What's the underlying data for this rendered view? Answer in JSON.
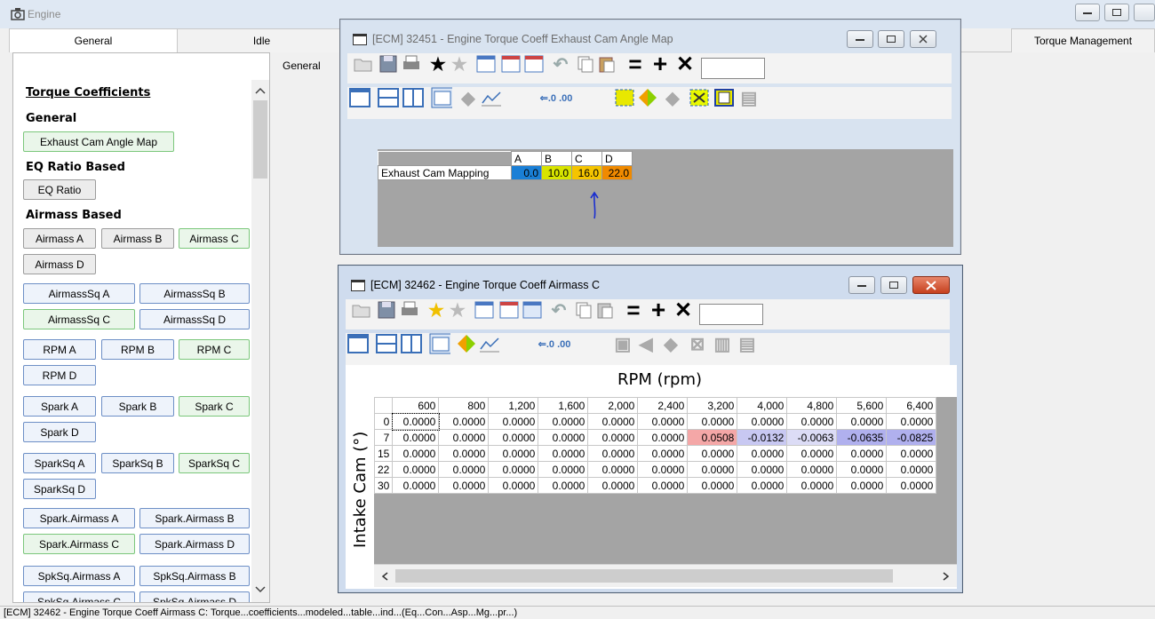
{
  "main": {
    "title": "Engine",
    "tabs": [
      "General",
      "Idle",
      "Torque Management"
    ],
    "active_tab": "General",
    "sub_tab": "General"
  },
  "panel": {
    "torque_heading": "Torque Coefficients",
    "general_heading": "General",
    "exhaust_button": "Exhaust Cam Angle Map",
    "eq_heading": "EQ Ratio Based",
    "eq_button": "EQ Ratio",
    "airmass_heading": "Airmass Based",
    "airmass": [
      "Airmass A",
      "Airmass B",
      "Airmass C",
      "Airmass D"
    ],
    "airmass_sq": [
      "AirmassSq A",
      "AirmassSq B",
      "AirmassSq C",
      "AirmassSq D"
    ],
    "rpm": [
      "RPM A",
      "RPM B",
      "RPM C",
      "RPM D"
    ],
    "spark": [
      "Spark A",
      "Spark B",
      "Spark C",
      "Spark D"
    ],
    "spark_sq": [
      "SparkSq A",
      "SparkSq B",
      "SparkSq C",
      "SparkSq D"
    ],
    "spark_airmass": [
      "Spark.Airmass A",
      "Spark.Airmass B",
      "Spark.Airmass C",
      "Spark.Airmass D"
    ],
    "spksq_airmass": [
      "SpkSq.Airmass A",
      "SpkSq.Airmass B",
      "SpkSq.Airmass C",
      "SpkSq.Airmass D"
    ]
  },
  "win1": {
    "title": "[ECM] 32451 - Engine Torque Coeff Exhaust Cam Angle Map",
    "table": {
      "columns": [
        "A",
        "B",
        "C",
        "D"
      ],
      "row_label": "Exhaust Cam Mapping",
      "values": [
        "0.0",
        "10.0",
        "16.0",
        "22.0"
      ],
      "colors": [
        "#1a7fd6",
        "#d8e400",
        "#f5c400",
        "#f08a00"
      ]
    }
  },
  "win2": {
    "title": "[ECM] 32462 - Engine Torque Coeff Airmass C",
    "x_axis_label": "RPM (rpm)",
    "y_axis_label": "Intake Cam (°)",
    "columns": [
      "600",
      "800",
      "1,200",
      "1,600",
      "2,000",
      "2,400",
      "3,200",
      "4,000",
      "4,800",
      "5,600",
      "6,400"
    ],
    "rows": [
      {
        "label": "0",
        "values": [
          "0.0000",
          "0.0000",
          "0.0000",
          "0.0000",
          "0.0000",
          "0.0000",
          "0.0000",
          "0.0000",
          "0.0000",
          "0.0000",
          "0.0000"
        ]
      },
      {
        "label": "7",
        "values": [
          "0.0000",
          "0.0000",
          "0.0000",
          "0.0000",
          "0.0000",
          "0.0000",
          "0.0508",
          "-0.0132",
          "-0.0063",
          "-0.0635",
          "-0.0825"
        ]
      },
      {
        "label": "15",
        "values": [
          "0.0000",
          "0.0000",
          "0.0000",
          "0.0000",
          "0.0000",
          "0.0000",
          "0.0000",
          "0.0000",
          "0.0000",
          "0.0000",
          "0.0000"
        ]
      },
      {
        "label": "22",
        "values": [
          "0.0000",
          "0.0000",
          "0.0000",
          "0.0000",
          "0.0000",
          "0.0000",
          "0.0000",
          "0.0000",
          "0.0000",
          "0.0000",
          "0.0000"
        ]
      },
      {
        "label": "30",
        "values": [
          "0.0000",
          "0.0000",
          "0.0000",
          "0.0000",
          "0.0000",
          "0.0000",
          "0.0000",
          "0.0000",
          "0.0000",
          "0.0000",
          "0.0000"
        ]
      }
    ],
    "cell_colors": {
      "pos": "#f4a7a7",
      "neg_light": "#dcdcf6",
      "neg_mid": "#c8c8f2",
      "neg_strong": "#b0b0ee"
    }
  },
  "status_text": "[ECM] 32462 - Engine Torque Coeff Airmass C: Torque...coefficients...modeled...table...ind...(Eq...Con...Asp...Mg...pr...)"
}
